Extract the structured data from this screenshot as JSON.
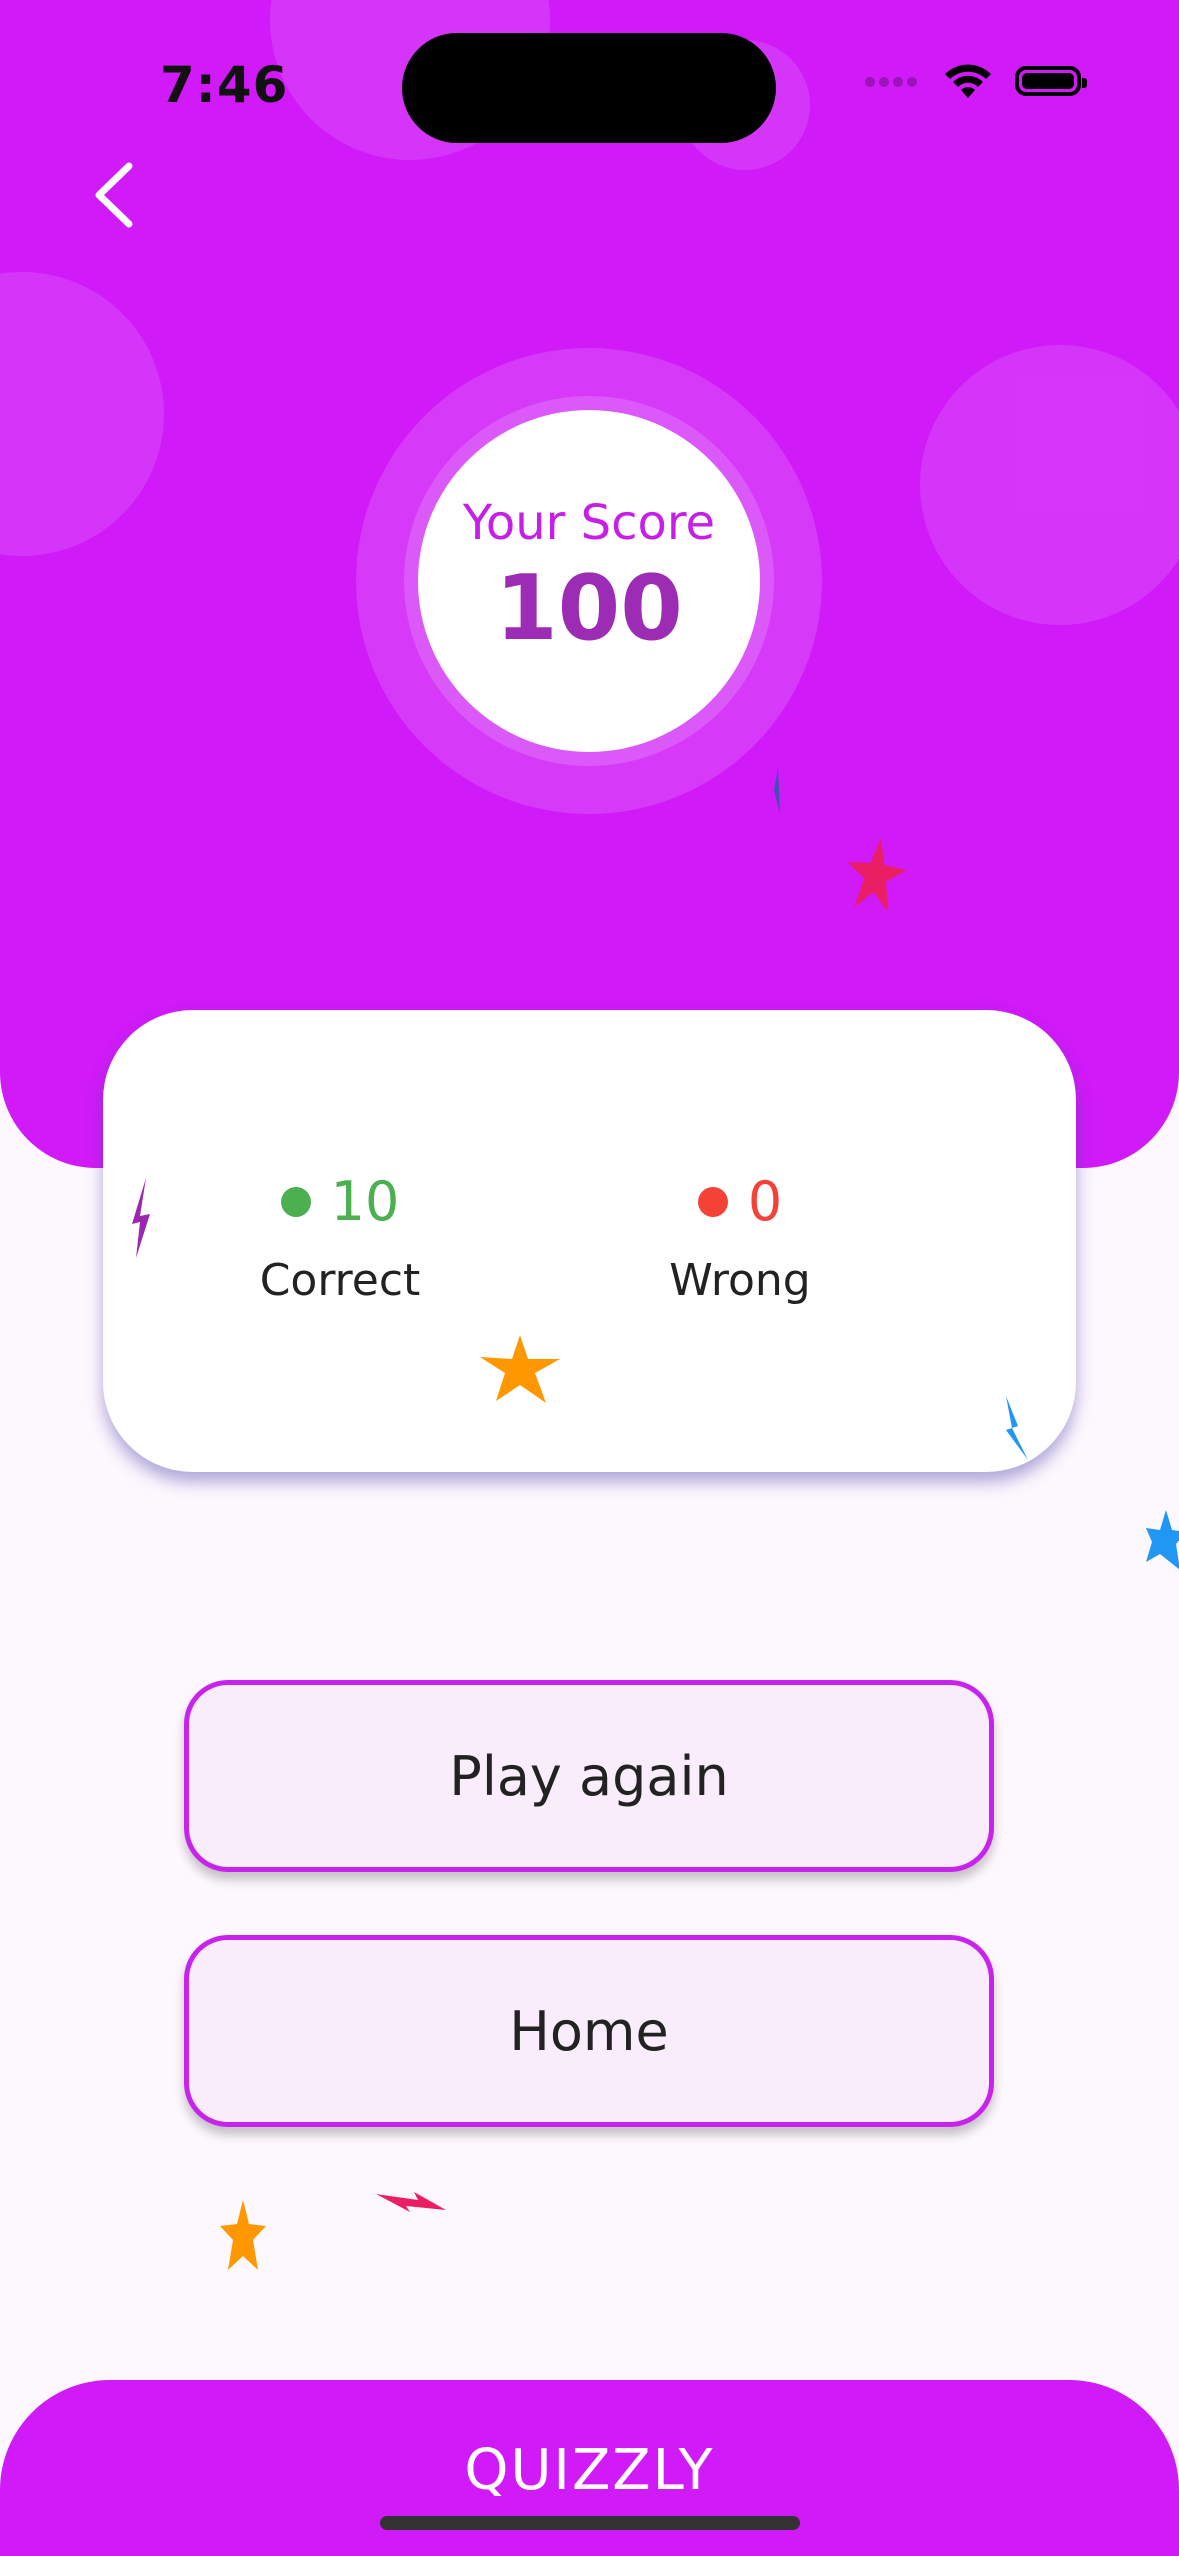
{
  "status_bar": {
    "time": "7:46"
  },
  "header": {
    "background_color": "#d01af7",
    "back_icon": "chevron-left-icon"
  },
  "score": {
    "label": "Your Score",
    "value": "100"
  },
  "stats": {
    "correct": {
      "value": "10",
      "label": "Correct",
      "color": "#4caf50"
    },
    "wrong": {
      "value": "0",
      "label": "Wrong",
      "color": "#f44336"
    }
  },
  "actions": {
    "play_again_label": "Play again",
    "home_label": "Home",
    "border_color": "#c723ec"
  },
  "footer": {
    "title": "QUIZZLY"
  }
}
